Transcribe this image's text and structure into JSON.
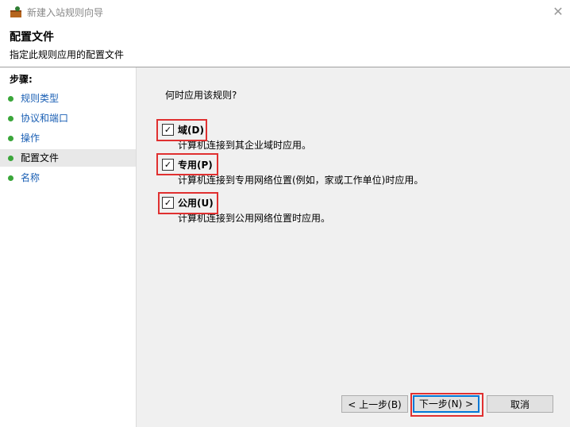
{
  "window": {
    "title": "新建入站规则向导",
    "close_glyph": "✕"
  },
  "header": {
    "title": "配置文件",
    "subtitle": "指定此规则应用的配置文件"
  },
  "sidebar": {
    "steps_label": "步骤:",
    "items": [
      {
        "label": "规则类型"
      },
      {
        "label": "协议和端口"
      },
      {
        "label": "操作"
      },
      {
        "label": "配置文件"
      },
      {
        "label": "名称"
      }
    ]
  },
  "main": {
    "question": "何时应用该规则?",
    "options": [
      {
        "label": "域(D)",
        "desc": "计算机连接到其企业域时应用。",
        "checked": true
      },
      {
        "label": "专用(P)",
        "desc": "计算机连接到专用网络位置(例如，家或工作单位)时应用。",
        "checked": true
      },
      {
        "label": "公用(U)",
        "desc": "计算机连接到公用网络位置时应用。",
        "checked": true
      }
    ]
  },
  "buttons": {
    "back": "< 上一步(B)",
    "next": "下一步(N) >",
    "cancel": "取消"
  },
  "colors": {
    "highlight": "#e03030",
    "accent": "#0078d7",
    "link": "#1a5fb4"
  }
}
